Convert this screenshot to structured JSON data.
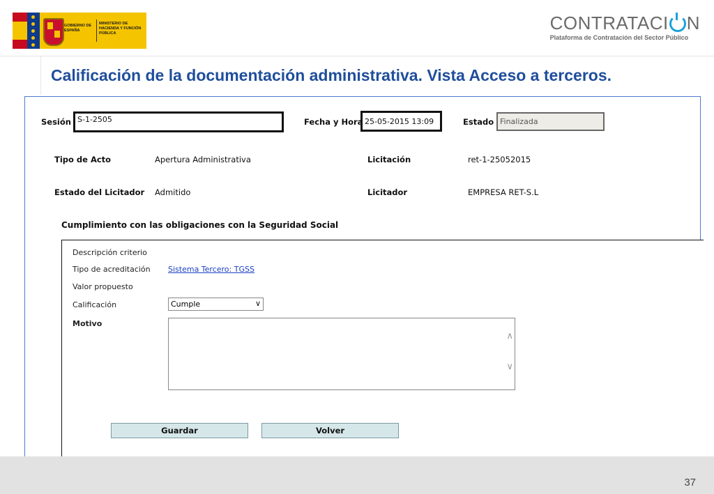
{
  "header": {
    "gov_text": "GOBIERNO DE ESPAÑA",
    "ministry_text": "MINISTERIO DE HACIENDA Y FUNCIÓN PÚBLICA",
    "brand_name_start": "CONTRATACI",
    "brand_name_end": "N",
    "brand_subtitle": "Plataforma de Contratación del Sector Público",
    "brand_color": "#1aa3d9"
  },
  "slide": {
    "title": "Calificación de la documentación administrativa. Vista Acceso a terceros.",
    "page_number": "37",
    "title_color": "#1f4e9c"
  },
  "form": {
    "sesion_label": "Sesión",
    "sesion_value": "S-1-2505",
    "fecha_label": "Fecha y Hora",
    "fecha_value": "25-05-2015 13:09",
    "estado_label": "Estado",
    "estado_value": "Finalizada",
    "tipo_acto_label": "Tipo de Acto",
    "tipo_acto_value": "Apertura Administrativa",
    "licitacion_label": "Licitación",
    "licitacion_value": "ret-1-25052015",
    "estado_licitador_label": "Estado del Licitador",
    "estado_licitador_value": "Admitido",
    "licitador_label": "Licitador",
    "licitador_value": "EMPRESA RET-S.L"
  },
  "criteria": {
    "section_title": "Cumplimiento con las obligaciones con la Seguridad Social",
    "descripcion_label": "Descripción criterio",
    "tipo_acreditacion_label": "Tipo de acreditación",
    "tipo_acreditacion_link": "Sistema Tercero: TGSS",
    "valor_propuesto_label": "Valor propuesto",
    "calificacion_label": "Calificación",
    "calificacion_selected": "Cumple",
    "motivo_label": "Motivo",
    "motivo_value": ""
  },
  "buttons": {
    "guardar": "Guardar",
    "volver": "Volver"
  },
  "icons": {
    "dropdown": "chevron-down-icon",
    "scroll_up": "chevron-up-icon",
    "scroll_down": "chevron-down-icon",
    "brand": "power-icon"
  }
}
